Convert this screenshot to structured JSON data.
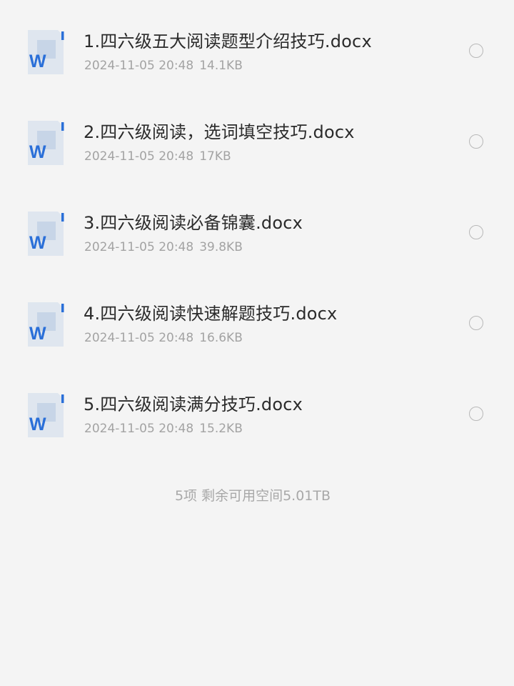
{
  "files": [
    {
      "name": "1.四六级五大阅读题型介绍技巧.docx",
      "date": "2024-11-05 20:48",
      "size": "14.1KB",
      "icon": "word-doc-icon"
    },
    {
      "name": "2.四六级阅读，选词填空技巧.docx",
      "date": "2024-11-05 20:48",
      "size": "17KB",
      "icon": "word-doc-icon"
    },
    {
      "name": "3.四六级阅读必备锦囊.docx",
      "date": "2024-11-05 20:48",
      "size": "39.8KB",
      "icon": "word-doc-icon"
    },
    {
      "name": "4.四六级阅读快速解题技巧.docx",
      "date": "2024-11-05 20:48",
      "size": "16.6KB",
      "icon": "word-doc-icon"
    },
    {
      "name": "5.四六级阅读满分技巧.docx",
      "date": "2024-11-05 20:48",
      "size": "15.2KB",
      "icon": "word-doc-icon"
    }
  ],
  "icon_glyph": "W",
  "summary": {
    "count": "5项",
    "space": "剩余可用空间5.01TB"
  },
  "colors": {
    "background": "#f4f4f4",
    "word_blue": "#2a6fd8",
    "doc_paper": "#dfe6ef",
    "text_primary": "#2b2b2b",
    "text_secondary": "#a3a3a3"
  }
}
